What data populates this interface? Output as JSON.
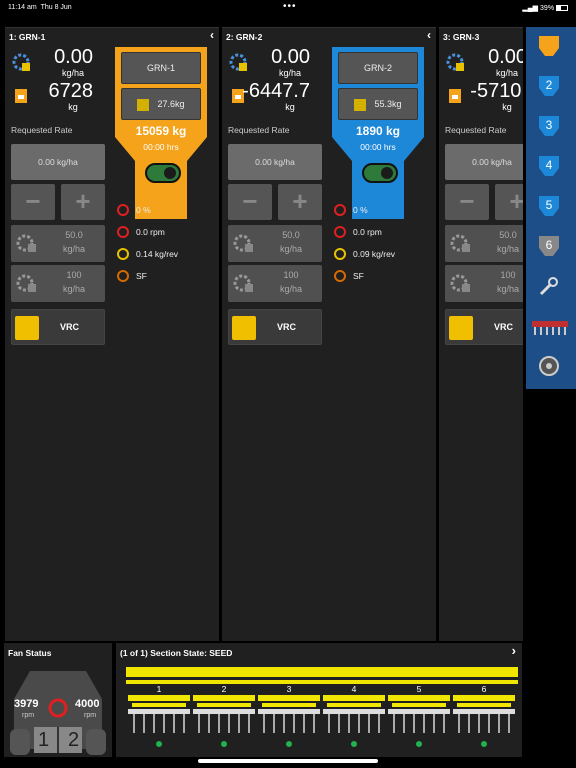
{
  "status_bar": {
    "time": "11:14 am",
    "date": "Thu 8 Jun",
    "dots": "•••",
    "battery": "39%"
  },
  "panels": [
    {
      "title": "1: GRN-1",
      "rate": "0.00",
      "rate_unit": "kg/ha",
      "weight": "6728",
      "weight_unit": "kg",
      "requested_label": "Requested Rate",
      "requested_value": "0.00 kg/ha",
      "minus": "−",
      "plus": "+",
      "gear1_value": "50.0",
      "gear1_unit": "kg/ha",
      "gear2_value": "100",
      "gear2_unit": "kg/ha",
      "vrc": "VRC",
      "tank_name": "GRN-1",
      "tank_weight": "27.6kg",
      "tank_total": "15059 kg",
      "tank_hrs": "00:00 hrs",
      "tank_color": "#f5a31a",
      "stats": [
        "0 %",
        "0.0 rpm",
        "0.14 kg/rev",
        "SF"
      ]
    },
    {
      "title": "2: GRN-2",
      "rate": "0.00",
      "rate_unit": "kg/ha",
      "weight": "-6447.7",
      "weight_unit": "kg",
      "requested_label": "Requested Rate",
      "requested_value": "0.00 kg/ha",
      "minus": "−",
      "plus": "+",
      "gear1_value": "50.0",
      "gear1_unit": "kg/ha",
      "gear2_value": "100",
      "gear2_unit": "kg/ha",
      "vrc": "VRC",
      "tank_name": "GRN-2",
      "tank_weight": "55.3kg",
      "tank_total": "1890 kg",
      "tank_hrs": "00:00 hrs",
      "tank_color": "#1e88d8",
      "stats": [
        "0 %",
        "0.0 rpm",
        "0.09 kg/rev",
        "SF"
      ]
    },
    {
      "title": "3: GRN-3",
      "rate": "0.00",
      "rate_unit": "kg/ha",
      "weight": "-5710.",
      "weight_unit": "kg",
      "requested_label": "Requested Rate",
      "requested_value": "0.00 kg/ha",
      "minus": "−",
      "plus": "+",
      "gear1_value": "50.0",
      "gear1_unit": "kg/ha",
      "gear2_value": "100",
      "gear2_unit": "kg/ha",
      "vrc": "VRC"
    }
  ],
  "sidebar": {
    "items": [
      "1",
      "2",
      "3",
      "4",
      "5",
      "6"
    ],
    "active_color": "#f5a31a"
  },
  "fan": {
    "title": "Fan Status",
    "left_value": "3979",
    "left_unit": "rpm",
    "right_value": "4000",
    "right_unit": "rpm",
    "left_num": "1",
    "right_num": "2"
  },
  "sections": {
    "title": "(1 of 1) Section State: SEED",
    "chevron": "›",
    "labels": [
      "1",
      "2",
      "3",
      "4",
      "5",
      "6"
    ]
  },
  "colors": {
    "accent_orange": "#f5a31a",
    "accent_blue": "#1e88d8",
    "toggle_green": "#2d7a3a",
    "section_yellow": "#f0e600",
    "status_green": "#22b14c"
  }
}
